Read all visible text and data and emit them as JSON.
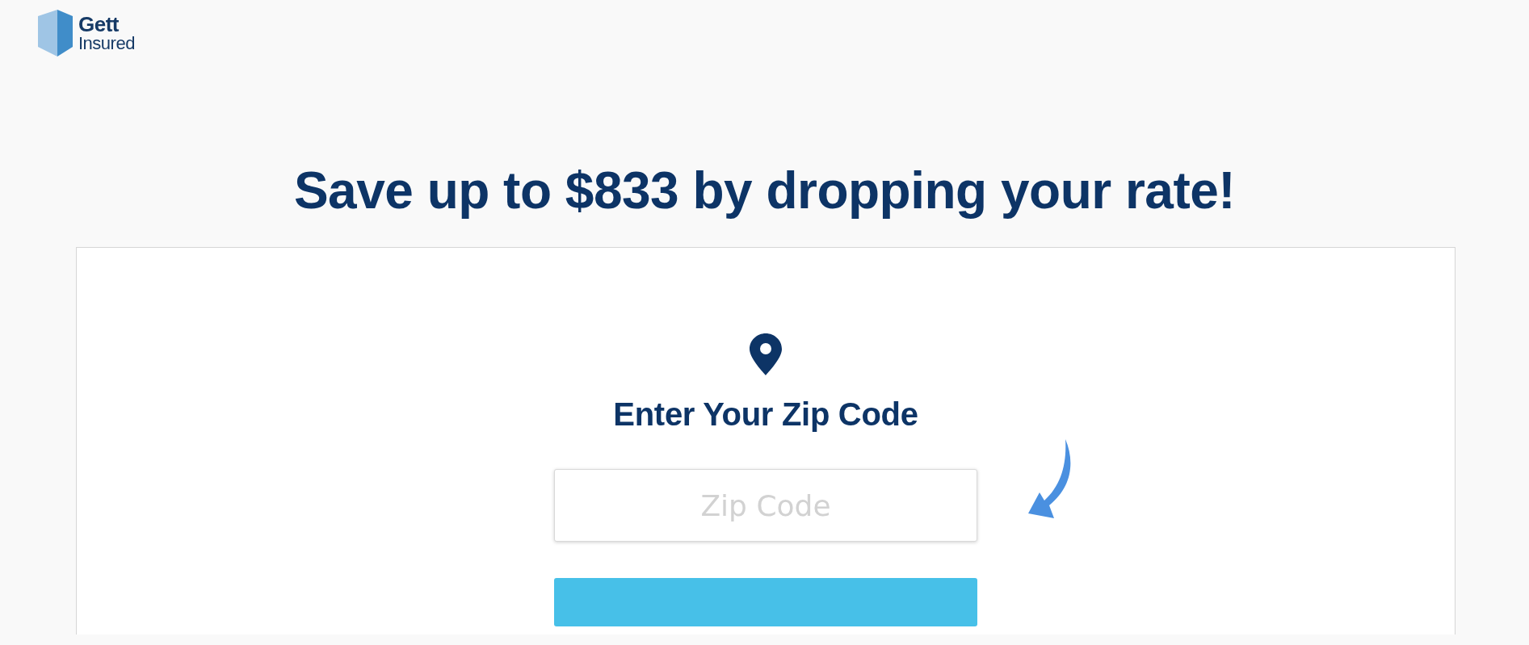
{
  "logo": {
    "line_1": "Gett",
    "line_2": "Insured"
  },
  "headline": "Save up to $833 by dropping your rate!",
  "form": {
    "heading": "Enter Your Zip Code",
    "zip_field": {
      "placeholder": "Zip Code"
    }
  }
}
